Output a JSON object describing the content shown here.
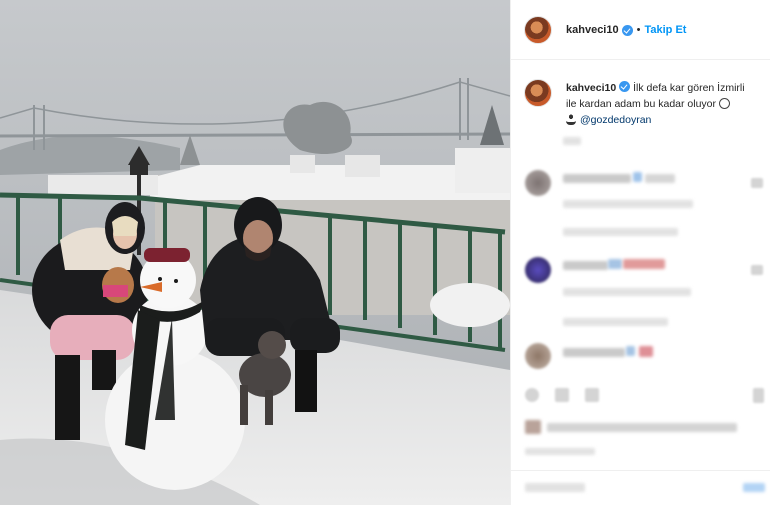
{
  "post": {
    "username": "kahveci10",
    "verified": true,
    "separator": "•",
    "follow_label": "Takip Et",
    "caption_line1": "İlk defa kar gören İzmirli",
    "caption_line2": "ile kardan adam bu kadar oluyor",
    "mention": "@gozdedoyran"
  },
  "icons": {
    "verified": "verified-badge-icon",
    "tear_face": "crying-face-emoji-icon",
    "person": "person-emoji-icon",
    "like": "heart-icon",
    "bookmark": "bookmark-icon"
  },
  "colors": {
    "accent": "#0095f6",
    "verified_badge": "#3897f0",
    "border": "#efefef",
    "text": "#262626"
  }
}
